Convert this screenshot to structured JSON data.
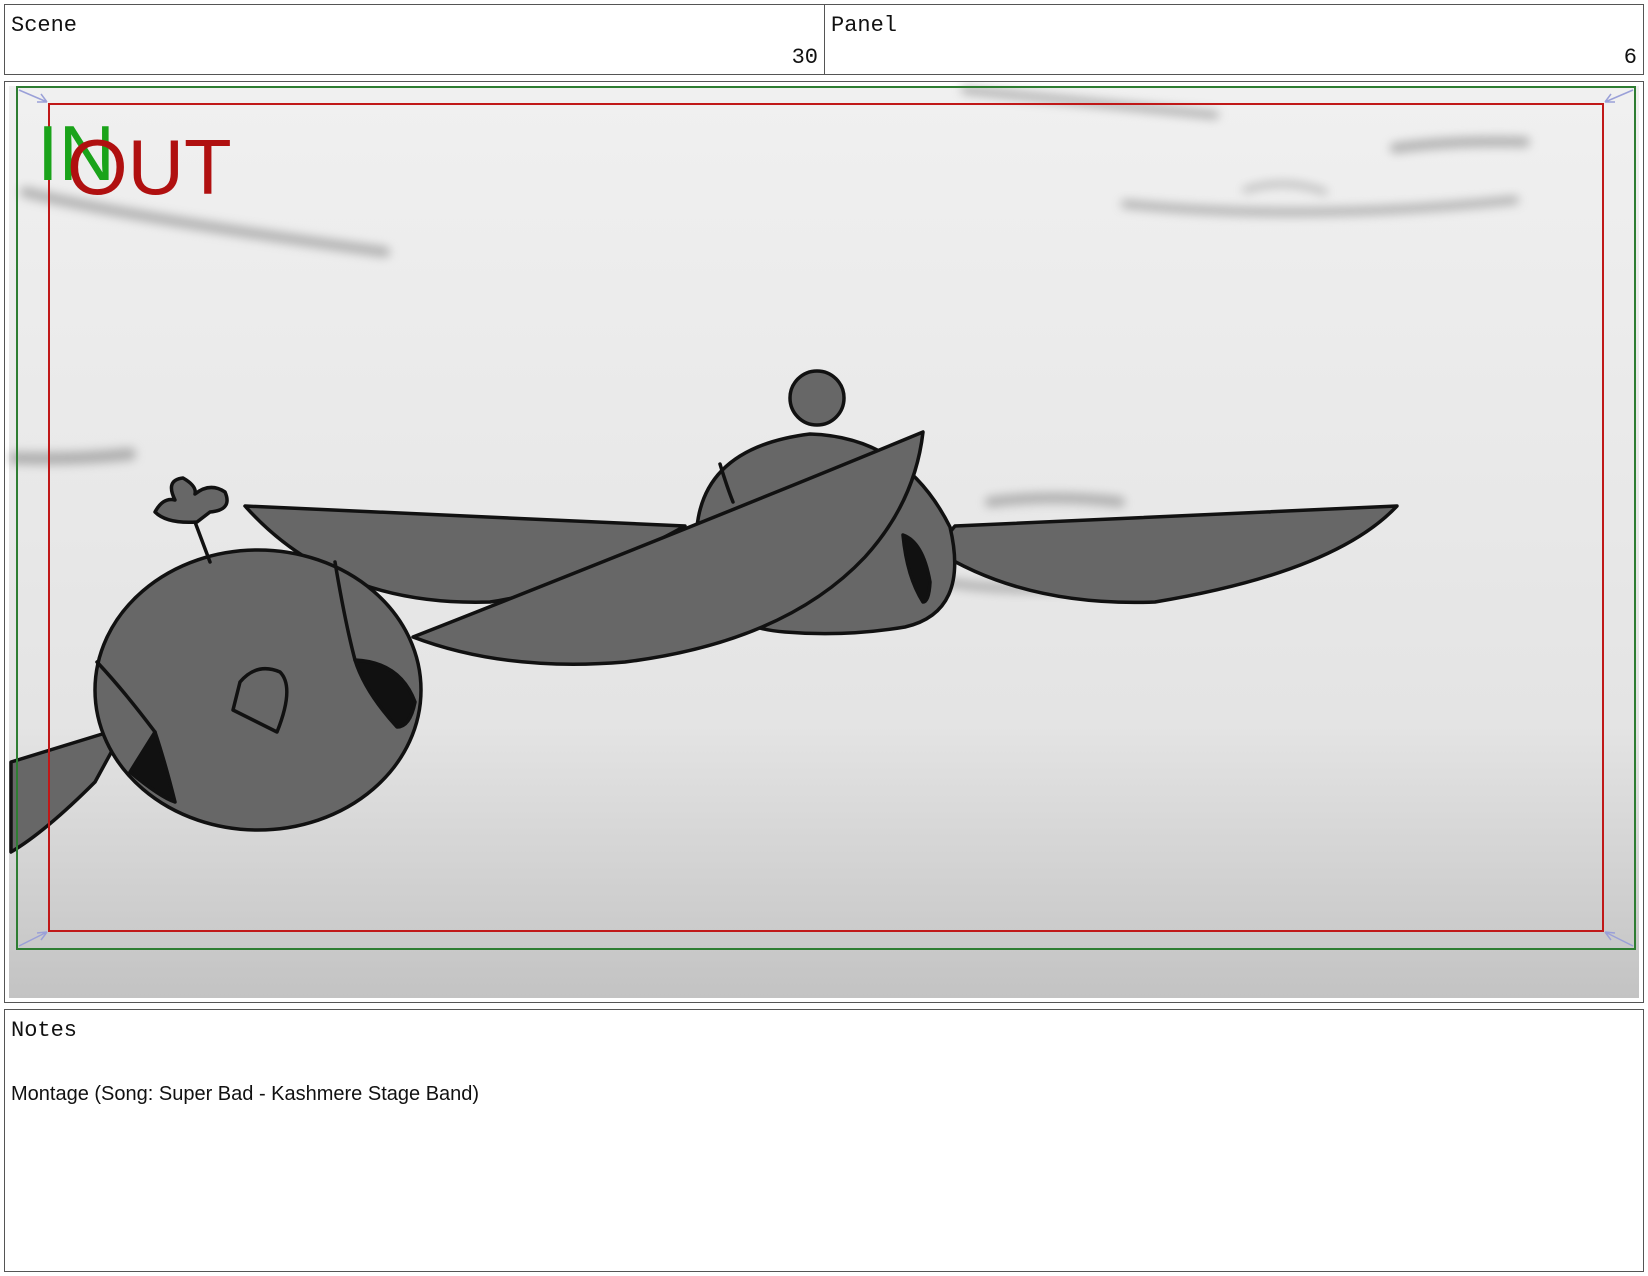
{
  "scene": {
    "label": "Scene",
    "value": "30"
  },
  "panel": {
    "label": "Panel",
    "value": "6"
  },
  "frame": {
    "in_marker": "IN",
    "out_marker": "OUT",
    "colors": {
      "in_marker": "#1aa31a",
      "out_marker": "#b01010",
      "safe_frame": "#2e7d32",
      "cam_frame": "#c01818",
      "character_fill": "#676767",
      "character_shadow": "#111111",
      "sky_top": "#f2f2f2",
      "sky_bottom": "#c4c4c4"
    }
  },
  "notes": {
    "label": "Notes",
    "text": "Montage (Song: Super Bad - Kashmere Stage Band)"
  }
}
